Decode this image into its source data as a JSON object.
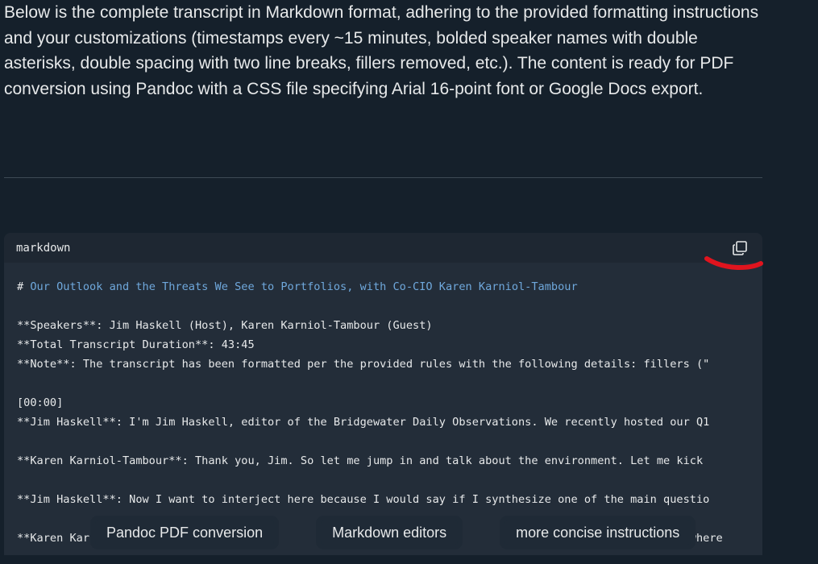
{
  "intro": {
    "text": "Below is the complete transcript in Markdown format, adhering to the provided formatting instructions and your customizations (timestamps every ~15 minutes, bolded speaker names with double asterisks, double spacing with two line breaks, fillers removed, etc.). The content is ready for PDF conversion using Pandoc with a CSS file specifying Arial 16-point font or Google Docs export."
  },
  "code": {
    "language": "markdown",
    "heading_hash": "# ",
    "heading_text": "Our Outlook and the Threats We See to Portfolios, with Co-CIO Karen Karniol-Tambour",
    "lines": [
      "**Speakers**: Jim Haskell (Host), Karen Karniol-Tambour (Guest)",
      "**Total Transcript Duration**: 43:45",
      "**Note**: The transcript has been formatted per the provided rules with the following details: fillers (\"",
      "",
      "[00:00]",
      "**Jim Haskell**: I'm Jim Haskell, editor of the Bridgewater Daily Observations. We recently hosted our Q1",
      "",
      "**Karen Karniol-Tambour**: Thank you, Jim. So let me jump in and talk about the environment. Let me kick",
      "",
      "**Jim Haskell**: Now I want to interject here because I would say if I synthesize one of the main questio",
      "",
      "**Karen Kar                                                                                   back to where"
    ]
  },
  "suggestions": [
    "Pandoc PDF conversion",
    "Markdown editors",
    "more concise instructions"
  ],
  "icons": {
    "copy": "copy-icon"
  },
  "colors": {
    "background": "#15202b",
    "code_bg": "#232d39",
    "heading": "#6fa8dc",
    "annotation": "#e0141e"
  }
}
